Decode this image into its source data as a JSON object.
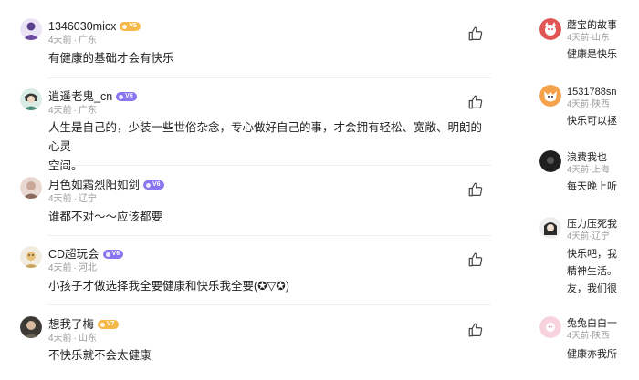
{
  "comments": [
    {
      "username": "1346030micx",
      "badge": "V5",
      "badge_color": "#f7b84a",
      "time": "4天前",
      "location": "广东",
      "content": "有健康的基础才会有快乐",
      "avatar_icon": "avatar-purple-figure"
    },
    {
      "username": "逍遥老鬼_cn",
      "badge": "V6",
      "badge_color": "#8a74f0",
      "time": "4天前",
      "location": "广东",
      "content_line1": "人生是自己的，少装一些世俗杂念，专心做好自己的事，才会拥有轻松、宽敞、明朗的心灵",
      "content_line2": "空间。",
      "avatar_icon": "avatar-anime-character"
    },
    {
      "username": "月色如霜烈阳如剑",
      "badge": "V6",
      "badge_color": "#8a74f0",
      "time": "4天前",
      "location": "辽宁",
      "content": "谁都不对～～应该都要",
      "avatar_icon": "avatar-portrait"
    },
    {
      "username": "CD超玩会",
      "badge": "V6",
      "badge_color": "#8a74f0",
      "time": "4天前",
      "location": "河北",
      "content": "小孩子才做选择我全要健康和快乐我全要(✪▽✪)",
      "avatar_icon": "avatar-cartoon"
    },
    {
      "username": "想我了梅",
      "badge": "V7",
      "badge_color": "#f7b84a",
      "time": "4天前",
      "location": "山东",
      "content": "不快乐就不会太健康",
      "avatar_icon": "avatar-photo"
    }
  ],
  "right_comments": [
    {
      "username": "蘑宝的故事",
      "time": "4天前",
      "location": "山东",
      "line1": "健康是快乐",
      "avatar_icon": "avatar-red-cat"
    },
    {
      "username": "1531788sn",
      "time": "4天前",
      "location": "陕西",
      "line1": "快乐可以拯",
      "avatar_icon": "avatar-orange-fox"
    },
    {
      "username": "浪费我也",
      "time": "4天前",
      "location": "上海",
      "line1": "每天晚上听",
      "avatar_icon": "avatar-dark"
    },
    {
      "username": "压力压死我",
      "time": "4天前",
      "location": "辽宁",
      "line1": "快乐吧，我",
      "line2": "精神生活。",
      "line3": "友，我们很",
      "avatar_icon": "avatar-girl"
    },
    {
      "username": "兔兔白白一",
      "time": "4天前",
      "location": "陕西",
      "line1": "健康亦我所",
      "avatar_icon": "avatar-pink"
    }
  ],
  "meta_separator": "·",
  "like_icon": "thumbs-up-icon"
}
